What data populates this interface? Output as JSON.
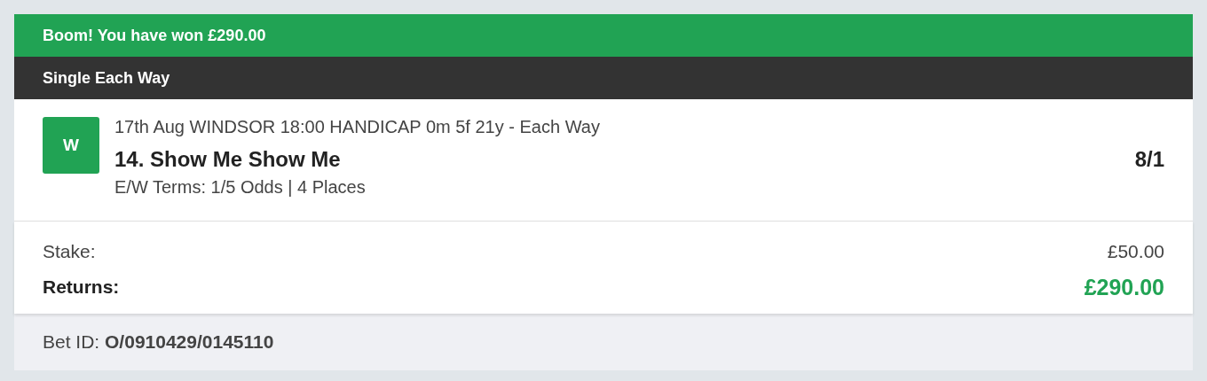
{
  "banner": {
    "text": "Boom! You have won £290.00",
    "won": true
  },
  "bet_type": "Single Each Way",
  "selection": {
    "result_badge": "W",
    "won": true,
    "event": "17th Aug WINDSOR 18:00 HANDICAP 0m 5f 21y - Each Way",
    "runner": "14. Show Me Show Me",
    "odds": "8/1",
    "terms": "E/W Terms: 1/5 Odds | 4 Places"
  },
  "totals": [
    {
      "label": "Stake:",
      "value": "£50.00",
      "kind": "plain"
    },
    {
      "label": "Returns:",
      "value": "£290.00",
      "kind": "returns"
    }
  ],
  "footer": {
    "bet_id": "Bet ID: **O/0910429/0145110**"
  }
}
